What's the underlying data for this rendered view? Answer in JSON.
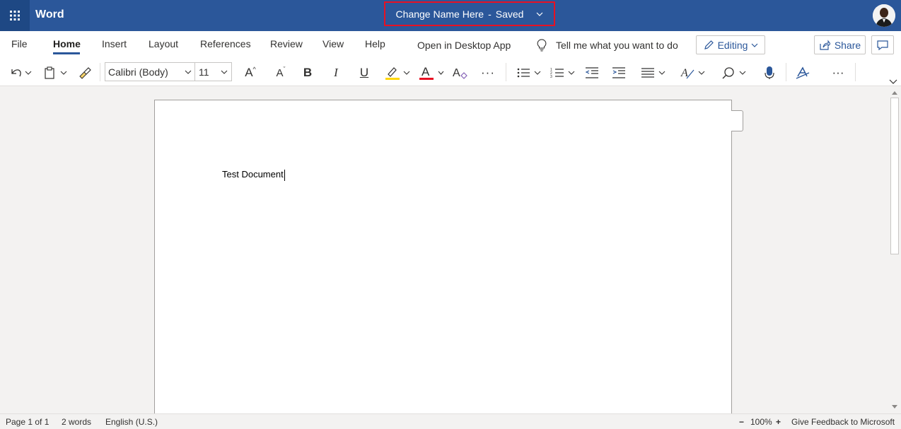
{
  "app": {
    "name": "Word"
  },
  "document": {
    "name": "Change Name Here",
    "separator": "-",
    "status": "Saved",
    "content": "Test Document"
  },
  "menu": {
    "tabs": [
      {
        "label": "File"
      },
      {
        "label": "Home"
      },
      {
        "label": "Insert"
      },
      {
        "label": "Layout"
      },
      {
        "label": "References"
      },
      {
        "label": "Review"
      },
      {
        "label": "View"
      },
      {
        "label": "Help"
      }
    ],
    "active_tab": "Home",
    "open_desktop": "Open in Desktop App",
    "tell_me": "Tell me what you want to do",
    "editing": "Editing",
    "share": "Share"
  },
  "ribbon": {
    "font_name": "Calibri (Body)",
    "font_size": "11",
    "grow_font": "A",
    "shrink_font": "A",
    "bold": "B",
    "italic": "I",
    "underline": "U",
    "font_color_letter": "A",
    "more": "···",
    "highlight_color": "#ffd700",
    "font_color": "#e81123"
  },
  "status": {
    "page": "Page 1 of 1",
    "words": "2 words",
    "language": "English (U.S.)",
    "zoom_out": "−",
    "zoom": "100%",
    "zoom_in": "+",
    "feedback": "Give Feedback to Microsoft"
  },
  "colors": {
    "titlebar": "#2b579a",
    "accent": "#2b579a",
    "highlight_border": "#e81123"
  },
  "icons": [
    "waffle-icon",
    "chevron-down-icon",
    "undo-icon",
    "clipboard-icon",
    "format-painter-icon",
    "bullets-icon",
    "numbering-icon",
    "decrease-indent-icon",
    "increase-indent-icon",
    "align-icon",
    "styles-icon",
    "find-icon",
    "dictate-icon",
    "editor-icon",
    "lightbulb-icon",
    "pencil-icon",
    "share-icon",
    "comment-icon"
  ]
}
